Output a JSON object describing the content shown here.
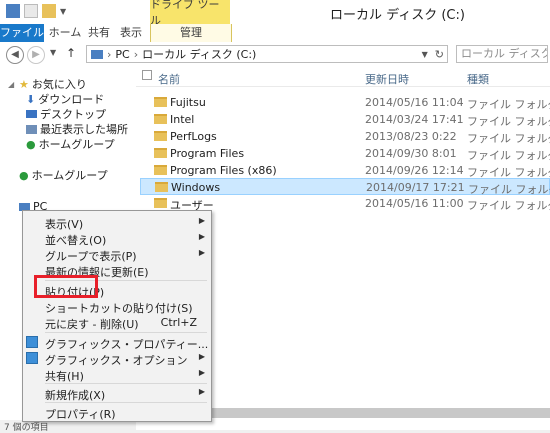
{
  "window": {
    "title": "ローカル ディスク (C:)",
    "contextual_tab": "ドライブ ツール"
  },
  "ribbon": {
    "tabs": [
      "ファイル",
      "ホーム",
      "共有",
      "表示"
    ],
    "manage": "管理"
  },
  "address": {
    "path": [
      "PC",
      "ローカル ディスク (C:)"
    ],
    "separator": "›",
    "search_placeholder": "ローカル ディスク (C:)の..."
  },
  "nav": {
    "favorites": "お気に入り",
    "downloads": "ダウンロード",
    "desktop": "デスクトップ",
    "recent": "最近表示した場所",
    "homegroup_fav": "ホームグループ",
    "homegroup": "ホームグループ",
    "pc": "PC"
  },
  "columns": {
    "name": "名前",
    "date": "更新日時",
    "type": "種類"
  },
  "files": [
    {
      "name": "Fujitsu",
      "date": "2014/05/16 11:04",
      "type": "ファイル フォルダー"
    },
    {
      "name": "Intel",
      "date": "2014/03/24 17:41",
      "type": "ファイル フォルダー"
    },
    {
      "name": "PerfLogs",
      "date": "2013/08/23 0:22",
      "type": "ファイル フォルダー"
    },
    {
      "name": "Program Files",
      "date": "2014/09/30 8:01",
      "type": "ファイル フォルダー"
    },
    {
      "name": "Program Files (x86)",
      "date": "2014/09/26 12:14",
      "type": "ファイル フォルダー"
    },
    {
      "name": "Windows",
      "date": "2014/09/17 17:21",
      "type": "ファイル フォルダー"
    },
    {
      "name": "ユーザー",
      "date": "2014/05/16 11:00",
      "type": "ファイル フォルダー"
    }
  ],
  "menu": {
    "view": "表示(V)",
    "sort": "並べ替え(O)",
    "group": "グループで表示(P)",
    "refresh": "最新の情報に更新(E)",
    "paste": "貼り付け(P)",
    "paste_shortcut": "ショートカットの貼り付け(S)",
    "undo": "元に戻す - 削除(U)",
    "undo_shortcut": "Ctrl+Z",
    "gfx_props": "グラフィックス・プロパティー...",
    "gfx_options": "グラフィックス・オプション",
    "share": "共有(H)",
    "new": "新規作成(X)",
    "properties": "プロパティ(R)"
  },
  "status": {
    "items": "7 個の項目"
  },
  "colors": {
    "file_tab": "#1979ca",
    "contextual": "#f8e46b",
    "selection": "#cce8ff",
    "highlight": "#e8202a"
  }
}
